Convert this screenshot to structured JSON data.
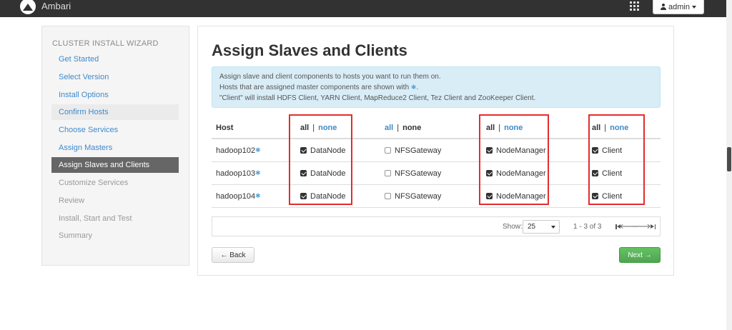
{
  "navbar": {
    "brand": "Ambari",
    "user": "admin"
  },
  "sidebar": {
    "header": "CLUSTER INSTALL WIZARD",
    "items": [
      {
        "label": "Get Started",
        "state": "link"
      },
      {
        "label": "Select Version",
        "state": "link"
      },
      {
        "label": "Install Options",
        "state": "link"
      },
      {
        "label": "Confirm Hosts",
        "state": "current"
      },
      {
        "label": "Choose Services",
        "state": "link"
      },
      {
        "label": "Assign Masters",
        "state": "link"
      },
      {
        "label": "Assign Slaves and Clients",
        "state": "active"
      },
      {
        "label": "Customize Services",
        "state": "muted"
      },
      {
        "label": "Review",
        "state": "muted"
      },
      {
        "label": "Install, Start and Test",
        "state": "muted"
      },
      {
        "label": "Summary",
        "state": "muted"
      }
    ]
  },
  "main": {
    "title": "Assign Slaves and Clients",
    "alert": {
      "line1": "Assign slave and client components to hosts you want to run them on.",
      "line2": "Hosts that are assigned master components are shown with",
      "line2_suffix": ".",
      "line3": "\"Client\" will install HDFS Client, YARN Client, MapReduce2 Client, Tez Client and ZooKeeper Client."
    },
    "table": {
      "host_header": "Host",
      "all": "all",
      "none": "none",
      "sep": "|",
      "rows": [
        {
          "host": "hadoop102",
          "components": [
            {
              "label": "DataNode",
              "checked": true
            },
            {
              "label": "NFSGateway",
              "checked": false
            },
            {
              "label": "NodeManager",
              "checked": true
            },
            {
              "label": "Client",
              "checked": true
            }
          ]
        },
        {
          "host": "hadoop103",
          "components": [
            {
              "label": "DataNode",
              "checked": true
            },
            {
              "label": "NFSGateway",
              "checked": false
            },
            {
              "label": "NodeManager",
              "checked": true
            },
            {
              "label": "Client",
              "checked": true
            }
          ]
        },
        {
          "host": "hadoop104",
          "components": [
            {
              "label": "DataNode",
              "checked": true
            },
            {
              "label": "NFSGateway",
              "checked": false
            },
            {
              "label": "NodeManager",
              "checked": true
            },
            {
              "label": "Client",
              "checked": true
            }
          ]
        }
      ]
    },
    "pager": {
      "show_label": "Show:",
      "page_size": "25",
      "info": "1 - 3 of 3"
    },
    "back_label": "← Back",
    "next_label": "Next →"
  },
  "colors": {
    "link": "#3e8acc",
    "active_bg": "#666666",
    "alert_bg": "#d9edf7",
    "highlight": "#e32d2d",
    "next_btn": "#5bb75b"
  }
}
